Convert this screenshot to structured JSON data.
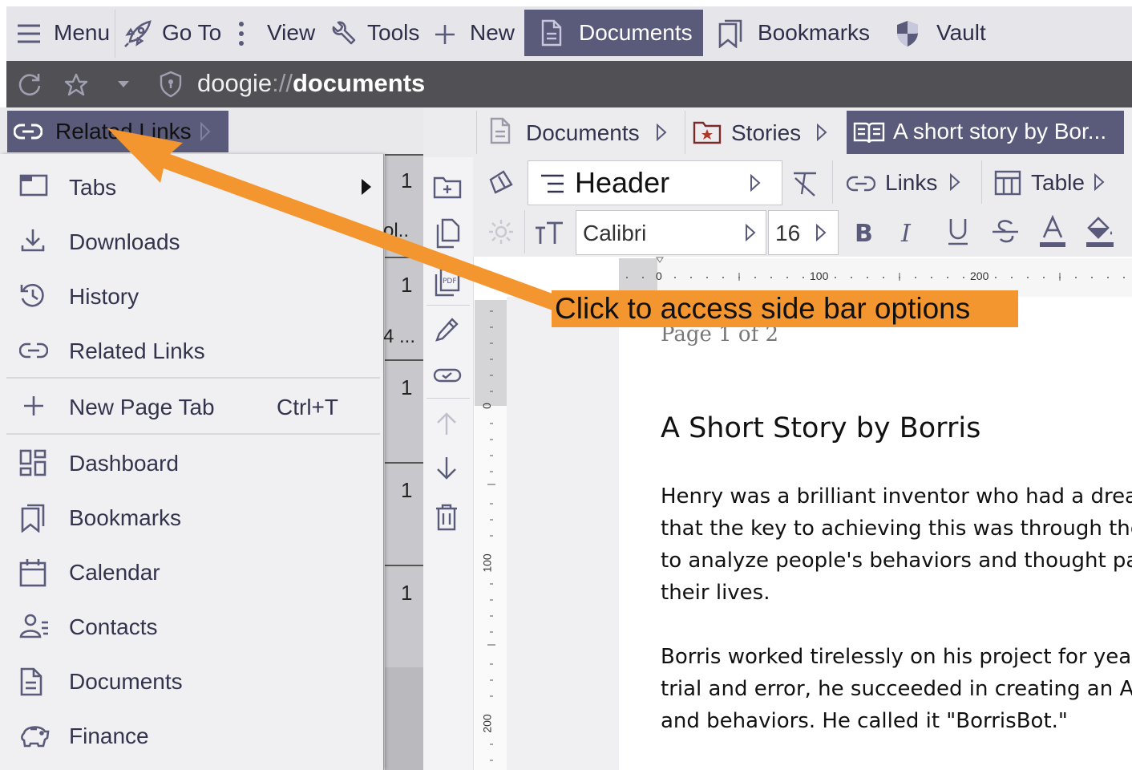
{
  "topbar": {
    "menu": "Menu",
    "goto": "Go To",
    "view": "View",
    "tools": "Tools",
    "new": "New",
    "documents": "Documents",
    "bookmarks": "Bookmarks",
    "vault": "Vault"
  },
  "address": {
    "scheme": "doogie",
    "separator": "://",
    "path": "documents"
  },
  "sidebar": {
    "related_links_label": "Related Links"
  },
  "menu": {
    "items": [
      {
        "label": "Tabs",
        "icon": "tabs-icon"
      },
      {
        "label": "Downloads",
        "icon": "download-icon"
      },
      {
        "label": "History",
        "icon": "history-icon"
      },
      {
        "label": "Related Links",
        "icon": "link-icon"
      },
      {
        "label": "New Page Tab",
        "shortcut": "Ctrl+T",
        "icon": "plus-icon"
      },
      {
        "label": "Dashboard",
        "icon": "dashboard-icon"
      },
      {
        "label": "Bookmarks",
        "icon": "bookmark-icon"
      },
      {
        "label": "Calendar",
        "icon": "calendar-icon"
      },
      {
        "label": "Contacts",
        "icon": "contacts-icon"
      },
      {
        "label": "Documents",
        "icon": "document-icon"
      },
      {
        "label": "Finance",
        "icon": "piggy-bank-icon"
      }
    ]
  },
  "background_column": {
    "numbers": [
      "1",
      "1",
      "1",
      "1",
      "1"
    ],
    "fragments": [
      "ol..",
      "4 ..."
    ]
  },
  "breadcrumbs": {
    "documents": "Documents",
    "stories": "Stories",
    "active": "A short story by Bor..."
  },
  "format": {
    "style": "Header",
    "links": "Links",
    "table": "Table",
    "font": "Calibri",
    "size": "16"
  },
  "ruler": {
    "top_ticks": [
      "0",
      "100",
      "200"
    ],
    "left_ticks": [
      "0",
      "100",
      "200"
    ]
  },
  "document": {
    "page_count": "Page 1 of 2",
    "title": "A Short Story by Borris",
    "paragraph1": [
      "Henry was a brilliant inventor who had a drea",
      "that the key to achieving this was through the",
      "to analyze people's behaviors and thought pa",
      "their lives."
    ],
    "paragraph2": [
      "Borris worked tirelessly on his project for yea",
      "trial and error, he succeeded in creating an AI",
      "and behaviors. He called it \"BorrisBot.\""
    ]
  },
  "annotation": {
    "text": "Click to access side bar options",
    "color": "#f4962f"
  },
  "colors": {
    "accent": "#5a5a7a",
    "topbar": "#e6e6ea",
    "addrbar": "#505055"
  }
}
